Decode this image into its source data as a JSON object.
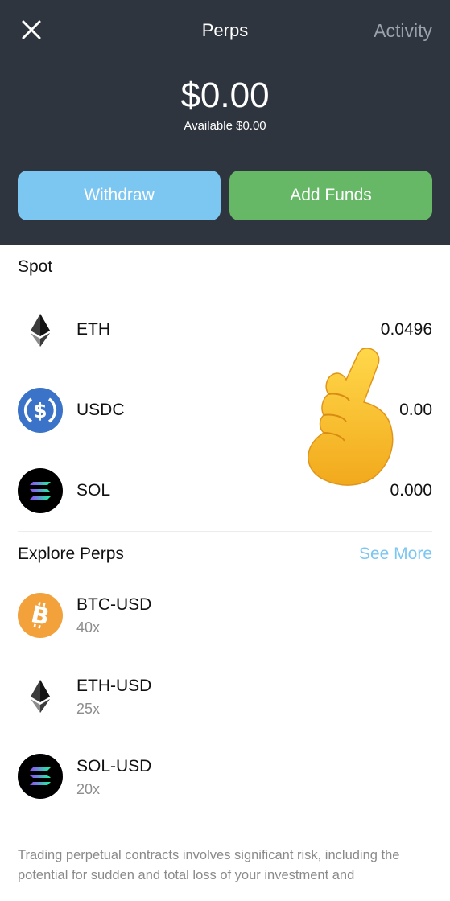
{
  "header": {
    "title": "Perps",
    "activity_label": "Activity",
    "balance": "$0.00",
    "available": "Available $0.00",
    "withdraw_label": "Withdraw",
    "add_funds_label": "Add Funds"
  },
  "spot": {
    "section_title": "Spot",
    "items": [
      {
        "symbol": "ETH",
        "amount": "0.0496",
        "icon": "ethereum-icon"
      },
      {
        "symbol": "USDC",
        "amount": "0.00",
        "icon": "usdc-icon"
      },
      {
        "symbol": "SOL",
        "amount": "0.000",
        "icon": "solana-icon"
      }
    ]
  },
  "perps": {
    "section_title": "Explore Perps",
    "see_more_label": "See More",
    "items": [
      {
        "pair": "BTC-USD",
        "leverage": "40x",
        "icon": "bitcoin-icon"
      },
      {
        "pair": "ETH-USD",
        "leverage": "25x",
        "icon": "ethereum-icon"
      },
      {
        "pair": "SOL-USD",
        "leverage": "20x",
        "icon": "solana-icon"
      }
    ]
  },
  "disclaimer": "Trading perpetual contracts involves significant risk, including the potential for sudden and total loss of your investment and",
  "colors": {
    "header_bg": "#2f353e",
    "withdraw": "#7cc6f2",
    "add_funds": "#66b866",
    "link": "#7cc6f2",
    "bitcoin": "#f2a13b",
    "usdc": "#3a73c8"
  },
  "overlay_icon": "pointing-hand-icon"
}
